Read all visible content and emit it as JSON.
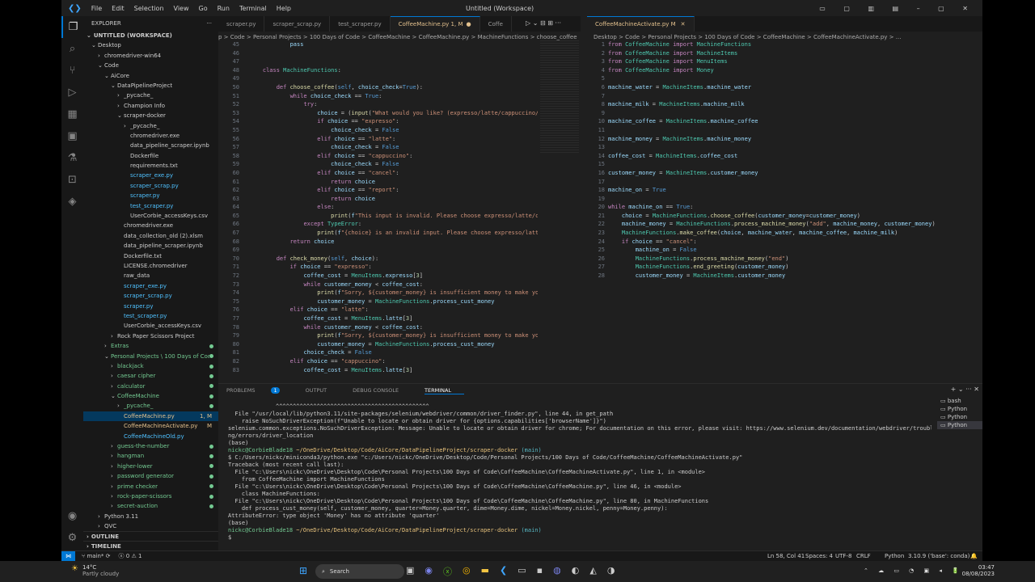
{
  "title": {
    "menu": [
      "File",
      "Edit",
      "Selection",
      "View",
      "Go",
      "Run",
      "Terminal",
      "Help"
    ],
    "window": "Untitled (Workspace)"
  },
  "sidebar": {
    "header": "EXPLORER",
    "workspace": "UNTITLED (WORKSPACE)",
    "items": [
      {
        "l": "Desktop",
        "d": 0,
        "t": "f",
        "o": 1
      },
      {
        "l": "chromedriver-win64",
        "d": 1,
        "t": "f"
      },
      {
        "l": "Code",
        "d": 1,
        "t": "f",
        "o": 1
      },
      {
        "l": "AiCore",
        "d": 2,
        "t": "f",
        "o": 1
      },
      {
        "l": "DataPipelineProject",
        "d": 3,
        "t": "f",
        "o": 1
      },
      {
        "l": "_pycache_",
        "d": 4,
        "t": "f"
      },
      {
        "l": "Champion Info",
        "d": 4,
        "t": "f"
      },
      {
        "l": "scraper-docker",
        "d": 4,
        "t": "f",
        "o": 1
      },
      {
        "l": "_pycache_",
        "d": 5,
        "t": "f"
      },
      {
        "l": "chromedriver.exe",
        "d": 5
      },
      {
        "l": "data_pipeline_scraper.ipynb",
        "d": 5
      },
      {
        "l": "Dockerfile",
        "d": 5
      },
      {
        "l": "requirements.txt",
        "d": 5
      },
      {
        "l": "scraper_exe.py",
        "d": 5
      },
      {
        "l": "scraper_scrap.py",
        "d": 5
      },
      {
        "l": "scraper.py",
        "d": 5
      },
      {
        "l": "test_scraper.py",
        "d": 5
      },
      {
        "l": "UserCorbie_accessKeys.csv",
        "d": 5
      },
      {
        "l": "chromedriver.exe",
        "d": 4
      },
      {
        "l": "data_collection_old (2).xlsm",
        "d": 4
      },
      {
        "l": "data_pipeline_scraper.ipynb",
        "d": 4
      },
      {
        "l": "Dockerfile.txt",
        "d": 4
      },
      {
        "l": "LICENSE.chromedriver",
        "d": 4
      },
      {
        "l": "raw_data",
        "d": 4
      },
      {
        "l": "scraper_exe.py",
        "d": 4
      },
      {
        "l": "scraper_scrap.py",
        "d": 4
      },
      {
        "l": "scraper.py",
        "d": 4
      },
      {
        "l": "test_scraper.py",
        "d": 4
      },
      {
        "l": "UserCorbie_accessKeys.csv",
        "d": 4
      },
      {
        "l": "Rock Paper Scissors Project",
        "d": 3,
        "t": "f"
      },
      {
        "l": "Extras",
        "d": 2,
        "t": "f",
        "g": 1
      },
      {
        "l": "Personal Projects \\ 100 Days of Code",
        "d": 2,
        "t": "f",
        "o": 1,
        "g": 1
      },
      {
        "l": "blackjack",
        "d": 3,
        "t": "f",
        "g": 1
      },
      {
        "l": "caesar cipher",
        "d": 3,
        "t": "f",
        "g": 1
      },
      {
        "l": "calculator",
        "d": 3,
        "t": "f",
        "g": 1
      },
      {
        "l": "CoffeeMachine",
        "d": 3,
        "t": "f",
        "o": 1,
        "g": 1
      },
      {
        "l": "_pycache_",
        "d": 4,
        "t": "f",
        "g": 1
      },
      {
        "l": "CoffeeMachine.py",
        "d": 4,
        "m": "1, M",
        "sel": 1
      },
      {
        "l": "CoffeeMachineActivate.py",
        "d": 4,
        "m": "M"
      },
      {
        "l": "CoffeeMachineOld.py",
        "d": 4
      },
      {
        "l": "guess-the-number",
        "d": 3,
        "t": "f",
        "g": 1
      },
      {
        "l": "hangman",
        "d": 3,
        "t": "f",
        "g": 1
      },
      {
        "l": "higher-lower",
        "d": 3,
        "t": "f",
        "g": 1
      },
      {
        "l": "password generator",
        "d": 3,
        "t": "f",
        "g": 1
      },
      {
        "l": "prime checker",
        "d": 3,
        "t": "f",
        "g": 1
      },
      {
        "l": "rock-paper-scissors",
        "d": 3,
        "t": "f",
        "g": 1
      },
      {
        "l": "secret-auction",
        "d": 3,
        "t": "f",
        "g": 1
      },
      {
        "l": "Python 3.11",
        "d": 1,
        "t": "f"
      },
      {
        "l": "QVC",
        "d": 1,
        "t": "f"
      }
    ],
    "outline": "OUTLINE",
    "timeline": "TIMELINE"
  },
  "tabs1": [
    "scraper.py",
    "scraper_scrap.py",
    "test_scraper.py",
    "CoffeeMachine.py 1, M",
    "Coffe"
  ],
  "tabs2": "CoffeeMachineActivate.py M",
  "bc1": "p > Code > Personal Projects > 100 Days of Code > CoffeeMachine > CoffeeMachine.py > MachineFunctions > choose_coffee",
  "bc2": "Desktop > Code > Personal Projects > 100 Days of Code > CoffeeMachine > CoffeeMachineActivate.py > ...",
  "left_start": 45,
  "left_code": [
    "            pass",
    "",
    "",
    "    class MachineFunctions:",
    "",
    "        def choose_coffee(self, choice_check=True):",
    "            while choice_check == True:",
    "                try:",
    "                    choice = (input(\"What would you like? (expresso/latte/cappuccino/c",
    "                    if choice == \"expresso\":",
    "                        choice_check = False",
    "                    elif choice == \"latte\":",
    "                        choice_check = False",
    "                    elif choice == \"cappuccino\":",
    "                        choice_check = False",
    "                    elif choice == \"cancel\":",
    "                        return choice",
    "                    elif choice == \"report\":",
    "                        return choice",
    "                    else:",
    "                        print(f\"This input is invalid. Please choose expresso/latte/ca",
    "                except TypeError:",
    "                    print(f\"{choice} is an invalid input. Please choose expresso/latte",
    "            return choice",
    "",
    "        def check_money(self, choice):",
    "            if choice == \"expresso\":",
    "                coffee_cost = MenuItems.expresso[3]",
    "                while customer_money < coffee_cost:",
    "                    print(f\"Sorry, ${customer_money} is insufficient money to make you",
    "                    customer_money = MachineFunctions.process_cust_money",
    "            elif choice == \"latte\":",
    "                coffee_cost = MenuItems.latte[3]",
    "                while customer_money < coffee_cost:",
    "                    print(f\"Sorry, ${customer_money} is insufficient money to make you",
    "                    customer_money = MachineFunctions.process_cust_money",
    "                choice_check = False",
    "            elif choice == \"cappuccino\":",
    "                coffee_cost = MenuItems.latte[3]"
  ],
  "right_code": [
    "from CoffeeMachine import MachineFunctions",
    "from CoffeeMachine import MachineItems",
    "from CoffeeMachine import MenuItems",
    "from CoffeeMachine import Money",
    "",
    "machine_water = MachineItems.machine_water",
    "",
    "machine_milk = MachineItems.machine_milk",
    "",
    "machine_coffee = MachineItems.machine_coffee",
    "",
    "machine_money = MachineItems.machine_money",
    "",
    "coffee_cost = MachineItems.coffee_cost",
    "",
    "customer_money = MachineItems.customer_money",
    "",
    "machine_on = True",
    "",
    "while machine_on == True:",
    "    choice = MachineFunctions.choose_coffee(customer_money=customer_money)",
    "    machine_money = MachineFunctions.process_machine_money(\"add\", machine_money, customer_money)",
    "    MachineFunctions.make_coffee(choice, machine_water, machine_coffee, machine_milk)",
    "    if choice == \"cancel\":",
    "        machine_on = False",
    "        MachineFunctions.process_machine_money(\"end\")",
    "        MachineFunctions.end_greeting(customer_money)",
    "        customer_money = MachineItems.customer_money"
  ],
  "panel": {
    "tabs": [
      "PROBLEMS",
      "OUTPUT",
      "DEBUG CONSOLE",
      "TERMINAL"
    ],
    "problems_count": "1",
    "shells": [
      "bash",
      "Python",
      "Python",
      "Python"
    ]
  },
  "terminal": [
    "              ^^^^^^^^^^^^^^^^^^^^^^^^^^^^^^^^^^^^^^^^^^^^^",
    "  File \"/usr/local/lib/python3.11/site-packages/selenium/webdriver/common/driver_finder.py\", line 44, in get_path",
    "    raise NoSuchDriverException(f\"Unable to locate or obtain driver for {options.capabilities['browserName']}\")",
    "selenium.common.exceptions.NoSuchDriverException: Message: Unable to locate or obtain driver for chrome; For documentation on this error, please visit: https://www.selenium.dev/documentation/webdriver/troubleshooti",
    "ng/errors/driver_location",
    "",
    "(base)",
    "nickc@CorbieBlade18 ~/OneDrive/Desktop/Code/AiCore/DataPipelineProject/scraper-docker (main)",
    "$ C:/Users/nickc/miniconda3/python.exe \"c:/Users/nickc/OneDrive/Desktop/Code/Personal Projects/100 Days of Code/CoffeeMachine/CoffeeMachineActivate.py\"",
    "Traceback (most recent call last):",
    "  File \"c:\\Users\\nickc\\OneDrive\\Desktop\\Code\\Personal Projects\\100 Days of Code\\CoffeeMachine\\CoffeeMachineActivate.py\", line 1, in <module>",
    "    from CoffeeMachine import MachineFunctions",
    "  File \"c:\\Users\\nickc\\OneDrive\\Desktop\\Code\\Personal Projects\\100 Days of Code\\CoffeeMachine\\CoffeeMachine.py\", line 46, in <module>",
    "    class MachineFunctions:",
    "  File \"c:\\Users\\nickc\\OneDrive\\Desktop\\Code\\Personal Projects\\100 Days of Code\\CoffeeMachine\\CoffeeMachine.py\", line 80, in MachineFunctions",
    "    def process_cust_money(self, customer_money, quarter=Money.quarter, dime=Money.dime, nickel=Money.nickel, penny=Money.penny):",
    "AttributeError: type object 'Money' has no attribute 'quarter'",
    "(base)",
    "nickc@CorbieBlade18 ~/OneDrive/Desktop/Code/AiCore/DataPipelineProject/scraper-docker (main)",
    "$ "
  ],
  "status": {
    "branch": "main*",
    "errors": "0",
    "warnings": "1",
    "pos": "Ln 58, Col 41",
    "spaces": "Spaces: 4",
    "enc": "UTF-8",
    "eol": "CRLF",
    "lang": "Python",
    "interp": "3.10.9 ('base': conda)"
  },
  "taskbar": {
    "temp": "14°C",
    "weather": "Partly cloudy",
    "search": "Search",
    "time": "03:47",
    "date": "08/08/2023"
  }
}
